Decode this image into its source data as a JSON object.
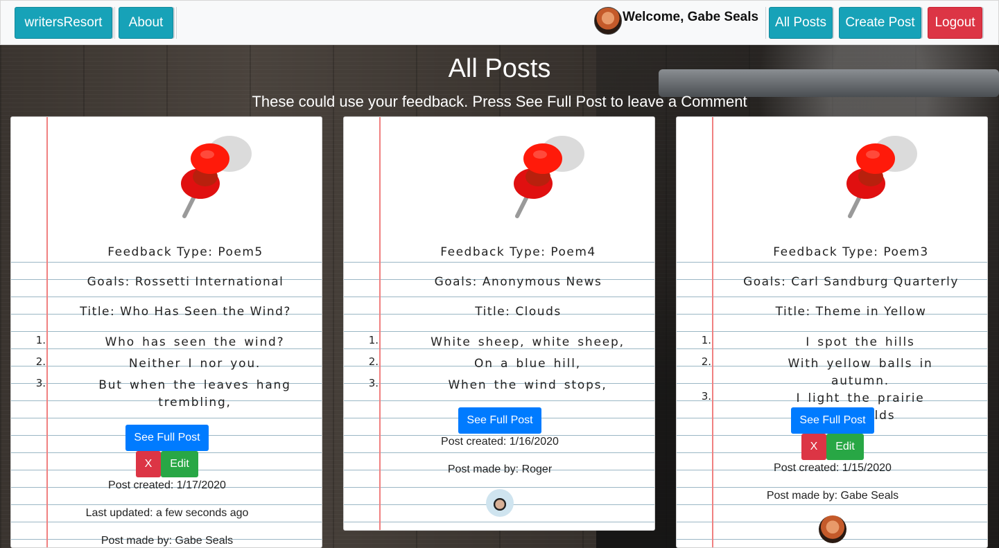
{
  "nav": {
    "brand": "writersResort",
    "about": "About",
    "welcome": "Welcome, Gabe Seals",
    "all_posts": "All Posts",
    "create_post": "Create Post",
    "logout": "Logout"
  },
  "header": {
    "title": "All Posts",
    "subtitle": "These could use your feedback. Press See Full Post to leave a Comment"
  },
  "colors": {
    "info": "#17a2b8",
    "danger": "#dc3545",
    "primary": "#007bff",
    "success": "#28a745",
    "margin_line": "#f08080"
  },
  "posts": [
    {
      "feedback": "Feedback Type: Poem5",
      "goals": "Goals: Rossetti International",
      "title": "Title: Who Has Seen the Wind?",
      "lines": [
        {
          "num": "1.",
          "text": "Who has seen the wind?"
        },
        {
          "num": "2.",
          "text": "Neither I nor you."
        },
        {
          "num": "3.",
          "text": "But when the leaves hang trembling,"
        }
      ],
      "see_full": "See Full Post",
      "delete": "X",
      "edit": "Edit",
      "created": "Post created: 1/17/2020",
      "updated": "Last updated: a few seconds ago",
      "author": "Post made by: Gabe Seals"
    },
    {
      "feedback": "Feedback Type: Poem4",
      "goals": "Goals: Anonymous News",
      "title": "Title: Clouds",
      "lines": [
        {
          "num": "1.",
          "text": "White sheep, white sheep,"
        },
        {
          "num": "2.",
          "text": "On a blue hill,"
        },
        {
          "num": "3.",
          "text": "When the wind stops,"
        }
      ],
      "see_full": "See Full Post",
      "created": "Post created: 1/16/2020",
      "author": "Post made by: Roger"
    },
    {
      "feedback": "Feedback Type: Poem3",
      "goals": "Goals: Carl Sandburg Quarterly",
      "title": "Title: Theme in Yellow",
      "lines": [
        {
          "num": "1.",
          "text": "I spot the hills"
        },
        {
          "num": "2.",
          "text": "With yellow balls in autumn."
        },
        {
          "num": "3.",
          "text": "I light the prairie cornfields"
        }
      ],
      "see_full": "See Full Post",
      "delete": "X",
      "edit": "Edit",
      "created": "Post created: 1/15/2020",
      "author": "Post made by: Gabe Seals"
    }
  ]
}
